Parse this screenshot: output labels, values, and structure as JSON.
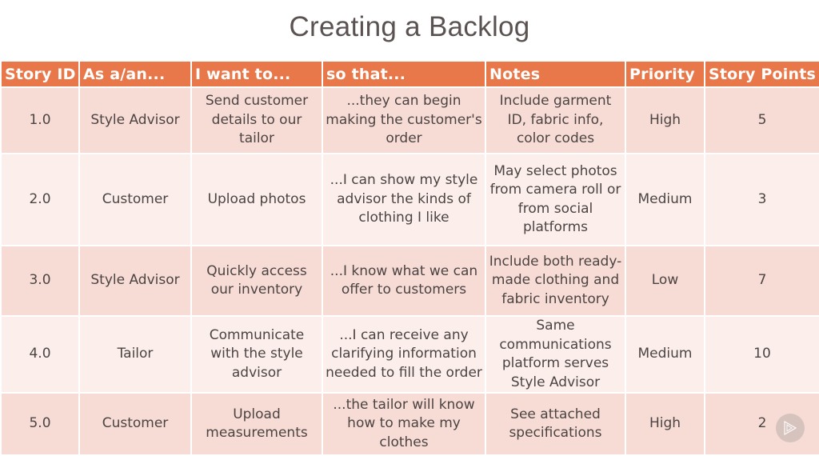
{
  "title": "Creating a Backlog",
  "table": {
    "headers": [
      "Story ID",
      "As a/an...",
      "I want to...",
      "so that...",
      "Notes",
      "Priority",
      "Story Points"
    ],
    "rows": [
      {
        "id": "1.0",
        "role": "Style Advisor",
        "want": "Send customer details to our tailor",
        "so_that": "...they can begin making the customer's order",
        "notes": "Include garment ID, fabric info, color codes",
        "priority": "High",
        "points": "5"
      },
      {
        "id": "2.0",
        "role": "Customer",
        "want": "Upload photos",
        "so_that": "...I can show my style advisor the kinds of clothing I like",
        "notes": "May select photos from camera roll or from social platforms",
        "priority": "Medium",
        "points": "3"
      },
      {
        "id": "3.0",
        "role": "Style Advisor",
        "want": "Quickly access our inventory",
        "so_that": "...I know what we can offer to customers",
        "notes": "Include both ready-made clothing and fabric inventory",
        "priority": "Low",
        "points": "7"
      },
      {
        "id": "4.0",
        "role": "Tailor",
        "want": "Communicate with the style advisor",
        "so_that": "...I can receive any clarifying information needed to fill the order",
        "notes": "Same communications platform serves Style Advisor",
        "priority": "Medium",
        "points": "10"
      },
      {
        "id": "5.0",
        "role": "Customer",
        "want": "Upload measurements",
        "so_that": "...the tailor will know how to make my clothes",
        "notes": "See attached specifications",
        "priority": "High",
        "points": "2"
      }
    ]
  },
  "colors": {
    "header_bg": "#e8784a",
    "row_odd_bg": "#f7dbd5",
    "row_even_bg": "#fbeeeb",
    "text": "#4c4443"
  },
  "overlay": {
    "icon": "play-logo-icon"
  }
}
